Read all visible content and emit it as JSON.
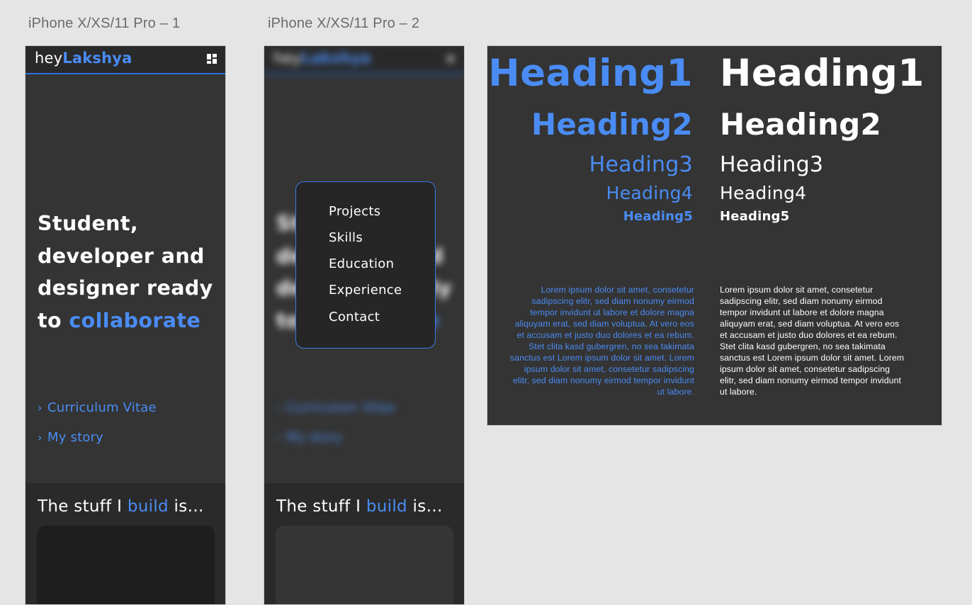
{
  "artboards": {
    "phone1_label": "iPhone X/XS/11 Pro – 1",
    "phone2_label": "iPhone X/XS/11 Pro – 2"
  },
  "app": {
    "logo_prefix": "hey",
    "logo_name": "Lakshya",
    "hero_line1": "Student,",
    "hero_line2": "developer and",
    "hero_line3": "designer ready",
    "hero_line4_prefix": "to ",
    "hero_line4_accent": "collaborate",
    "link_cv": "Curriculum Vitae",
    "link_story": "My story",
    "link_chevron": "›",
    "stuff_prefix": "The stuff I ",
    "stuff_accent": "build",
    "stuff_suffix": " is…"
  },
  "menu": {
    "items": [
      "Projects",
      "Skills",
      "Education",
      "Experience",
      "Contact"
    ]
  },
  "typography": {
    "heading1": "Heading1",
    "heading2": "Heading2",
    "heading3": "Heading3",
    "heading4": "Heading4",
    "heading5": "Heading5",
    "paragraph": "Lorem ipsum dolor sit amet, consetetur sadipscing elitr, sed diam nonumy eirmod tempor invidunt ut labore et dolore magna aliquyam erat, sed diam voluptua. At vero eos et accusam et justo duo dolores et ea rebum. Stet clita kasd gubergren, no sea takimata sanctus est Lorem ipsum dolor sit amet. Lorem ipsum dolor sit amet, consetetur sadipscing elitr, sed diam nonumy eirmod tempor invidunt ut labore."
  },
  "colors": {
    "accent": "#4a8cf4",
    "background": "#343434",
    "navbar": "#292929",
    "canvas": "#e5e5e5"
  },
  "icons": {
    "menu": "dashboard-grid-icon",
    "close": "close-icon",
    "chevron": "chevron-right-icon"
  }
}
